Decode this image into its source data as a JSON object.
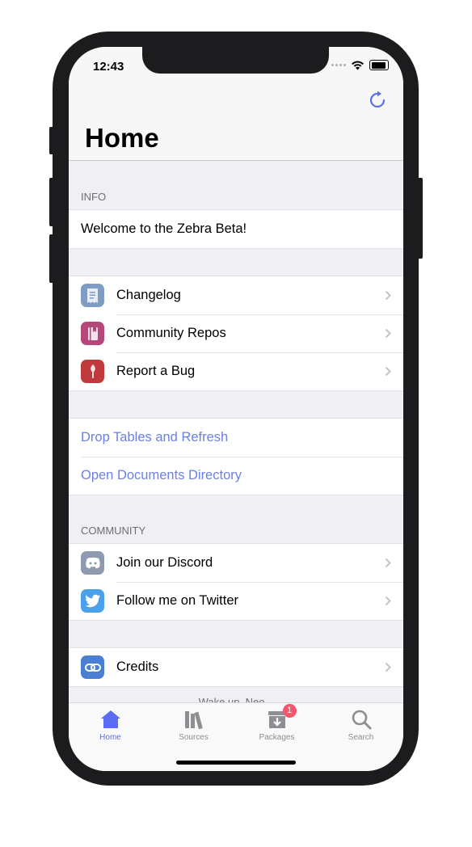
{
  "status": {
    "time": "12:43"
  },
  "nav": {
    "title": "Home"
  },
  "info": {
    "header": "INFO",
    "welcome": "Welcome to the Zebra Beta!"
  },
  "links": [
    {
      "label": "Changelog",
      "icon": "receipt-icon",
      "color": "#7e9cc4"
    },
    {
      "label": "Community Repos",
      "icon": "book-icon",
      "color": "#b5487a"
    },
    {
      "label": "Report a Bug",
      "icon": "bug-icon",
      "color": "#c0393c"
    }
  ],
  "actions": [
    {
      "label": "Drop Tables and Refresh"
    },
    {
      "label": "Open Documents Directory"
    }
  ],
  "community": {
    "header": "COMMUNITY",
    "items": [
      {
        "label": "Join our Discord",
        "icon": "discord-icon",
        "color": "#8e9aaf"
      },
      {
        "label": "Follow me on Twitter",
        "icon": "twitter-icon",
        "color": "#4aa1eb"
      }
    ]
  },
  "credits": {
    "label": "Credits",
    "icon": "link-icon",
    "color": "#4a7fd4"
  },
  "footer": "Wake up, Neo...",
  "tabs": [
    {
      "label": "Home",
      "icon": "house-icon",
      "active": true
    },
    {
      "label": "Sources",
      "icon": "books-icon"
    },
    {
      "label": "Packages",
      "icon": "package-icon",
      "badge": "1"
    },
    {
      "label": "Search",
      "icon": "magnifier-icon"
    }
  ],
  "colors": {
    "accent": "#5b6ef2",
    "link": "#6b80e8",
    "badge": "#f4566c"
  }
}
